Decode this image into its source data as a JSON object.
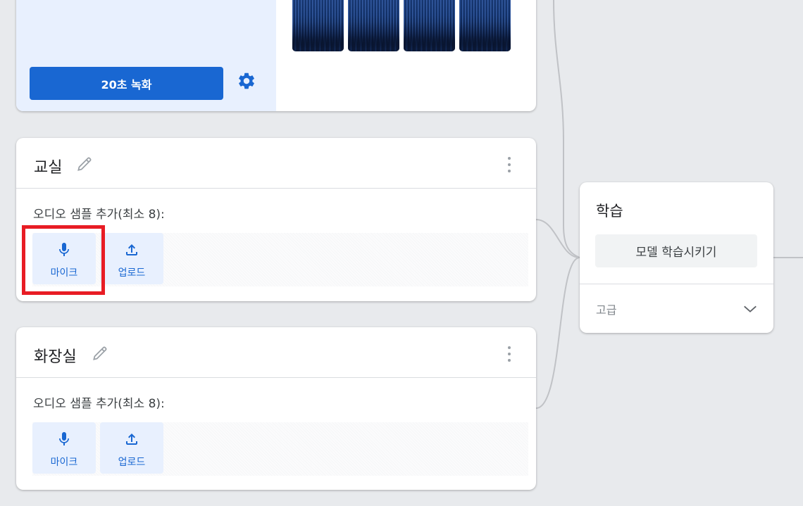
{
  "top_card": {
    "record_button_label": "20초 녹화",
    "settings_icon": "gear-icon",
    "thumbnail_count": 4
  },
  "classes": [
    {
      "name": "교실",
      "sample_label": "오디오 샘플 추가(최소 8):",
      "mic_label": "마이크",
      "upload_label": "업로드",
      "highlighted": true
    },
    {
      "name": "화장실",
      "sample_label": "오디오 샘플 추가(최소 8):",
      "mic_label": "마이크",
      "upload_label": "업로드",
      "highlighted": false
    }
  ],
  "training": {
    "title": "학습",
    "train_button_label": "모델 학습시키기",
    "advanced_label": "고급"
  },
  "colors": {
    "accent": "#1967d2",
    "accent_light": "#e8f0fe",
    "highlight": "#e81c24",
    "background": "#e8eaed"
  }
}
